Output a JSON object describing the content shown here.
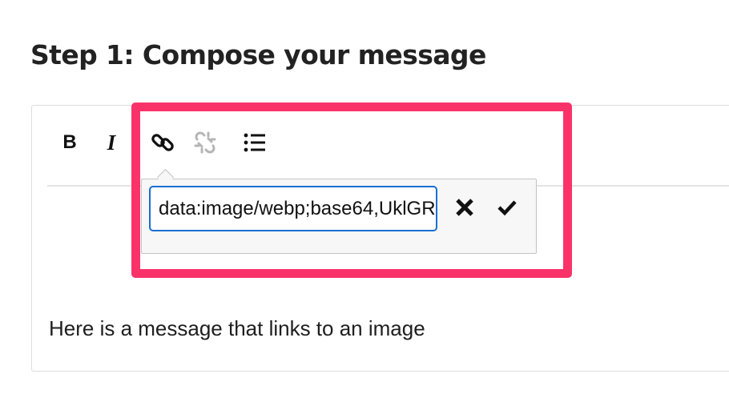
{
  "page": {
    "heading": "Step 1: Compose your message"
  },
  "toolbar": {
    "bold_label": "B",
    "italic_label": "I",
    "link_icon": "link-icon",
    "unlink_icon": "unlink-icon",
    "list_icon": "bullet-list-icon"
  },
  "link_popup": {
    "url_value": "data:image/webp;base64,UklGR",
    "cancel_icon": "close-icon",
    "confirm_icon": "checkmark-icon"
  },
  "editor": {
    "content": "Here is a message that links to an image"
  },
  "colors": {
    "highlight": "#f9336a",
    "input_focus": "#1a6ed0",
    "disabled_icon": "#b5b5b5"
  }
}
